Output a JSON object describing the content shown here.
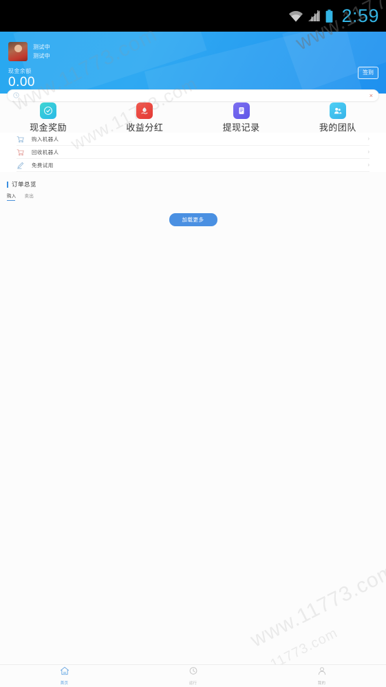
{
  "statusbar": {
    "time": "2:59",
    "icons": [
      "wifi-icon",
      "cellular-signal-icon",
      "battery-icon"
    ]
  },
  "header": {
    "accent_color": "#2fa9f2",
    "profile": {
      "avatar": "user-avatar",
      "line1": "测试中",
      "line2": "测试中"
    },
    "balance_label": "现金余额",
    "balance_value": "0.00",
    "action_button": "签到"
  },
  "notice": {
    "icon": "megaphone-icon",
    "text": "",
    "close": "×"
  },
  "quick_grid": [
    {
      "icon": "cash-reward-icon",
      "label": "现金奖励",
      "color": "#33c9dd"
    },
    {
      "icon": "profit-dividend-icon",
      "label": "收益分红",
      "color": "#e8443c"
    },
    {
      "icon": "withdraw-record-icon",
      "label": "提现记录",
      "color": "#6b60ec"
    },
    {
      "icon": "my-team-icon",
      "label": "我的团队",
      "color": "#41bdee"
    }
  ],
  "menu_list": [
    {
      "icon": "cart-buy-icon",
      "label": "购入机器人",
      "chevron": "›"
    },
    {
      "icon": "cart-recycle-icon",
      "label": "回收机器人",
      "chevron": "›"
    },
    {
      "icon": "pen-trial-icon",
      "label": "免费试用",
      "chevron": "›"
    }
  ],
  "overview": {
    "title": "订单总览",
    "accent_color": "#3a8fe0",
    "tabs": [
      {
        "label": "购入",
        "active": true
      },
      {
        "label": "卖出",
        "active": false
      }
    ]
  },
  "load_more": {
    "label": "加载更多",
    "color": "#4a90e2"
  },
  "watermarks": {
    "a": "www.11773.com",
    "b": "www.11773.com",
    "c": "www.11773.com",
    "d": "www.11773.com",
    "e": "www.11773.com"
  },
  "bottomnav": [
    {
      "icon": "home-icon",
      "label": "首页",
      "active": true
    },
    {
      "icon": "clock-icon",
      "label": "运行",
      "active": false
    },
    {
      "icon": "person-icon",
      "label": "我的",
      "active": false
    }
  ]
}
